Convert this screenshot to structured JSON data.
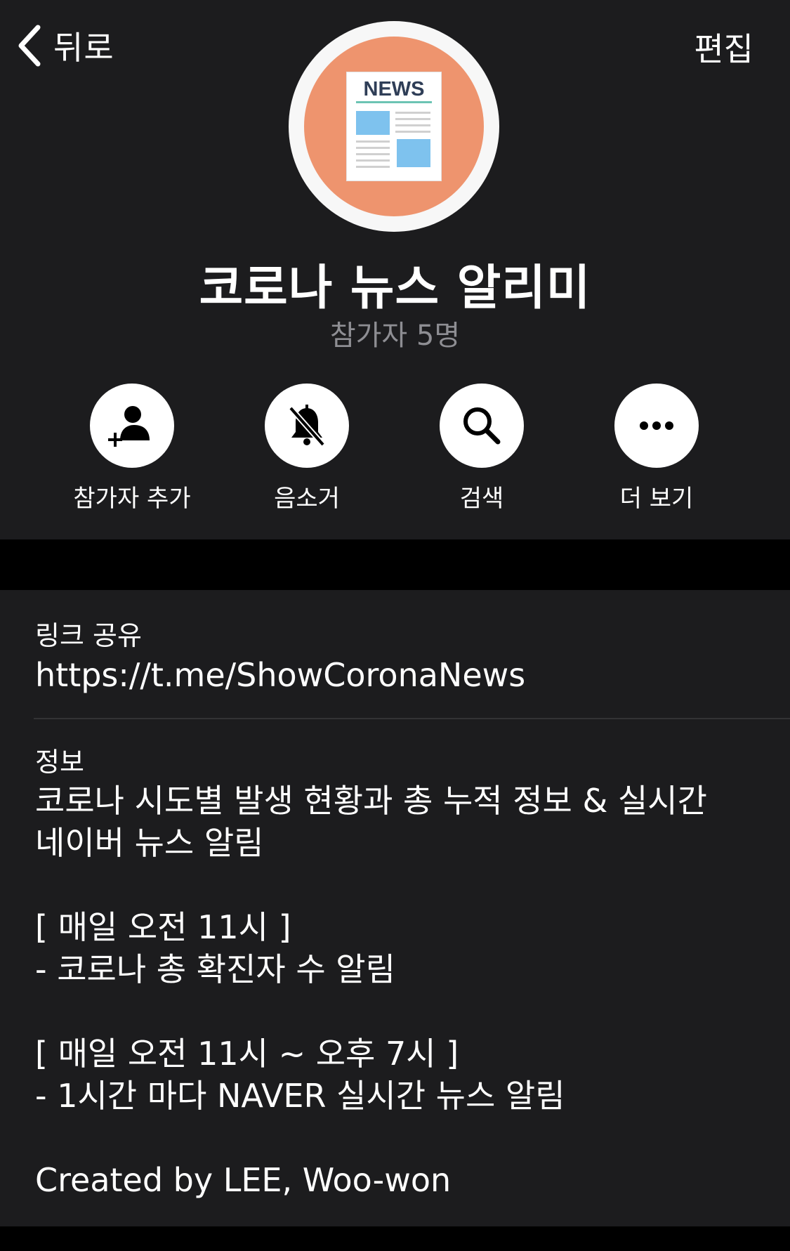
{
  "nav": {
    "back_label": "뒤로",
    "edit_label": "편집"
  },
  "avatar": {
    "news_text": "NEWS",
    "bg_color": "#ee946e"
  },
  "group": {
    "title": "코로나 뉴스 알리미",
    "members": "참가자 5명"
  },
  "actions": [
    {
      "label": "참가자 추가",
      "icon": "add-user-icon"
    },
    {
      "label": "음소거",
      "icon": "bell-slash-icon"
    },
    {
      "label": "검색",
      "icon": "search-icon"
    },
    {
      "label": "더 보기",
      "icon": "more-icon"
    }
  ],
  "link": {
    "label": "링크 공유",
    "value": "https://t.me/ShowCoronaNews"
  },
  "info": {
    "label": "정보",
    "lines": [
      "코로나 시도별 발생 현황과 총 누적 정보 & 실시간",
      "네이버 뉴스 알림",
      "",
      "[ 매일 오전 11시 ]",
      "- 코로나 총 확진자 수 알림",
      "",
      "[ 매일 오전 11시 ~ 오후 7시 ]",
      "- 1시간 마다 NAVER 실시간 뉴스 알림",
      "",
      "Created by LEE, Woo-won"
    ]
  }
}
